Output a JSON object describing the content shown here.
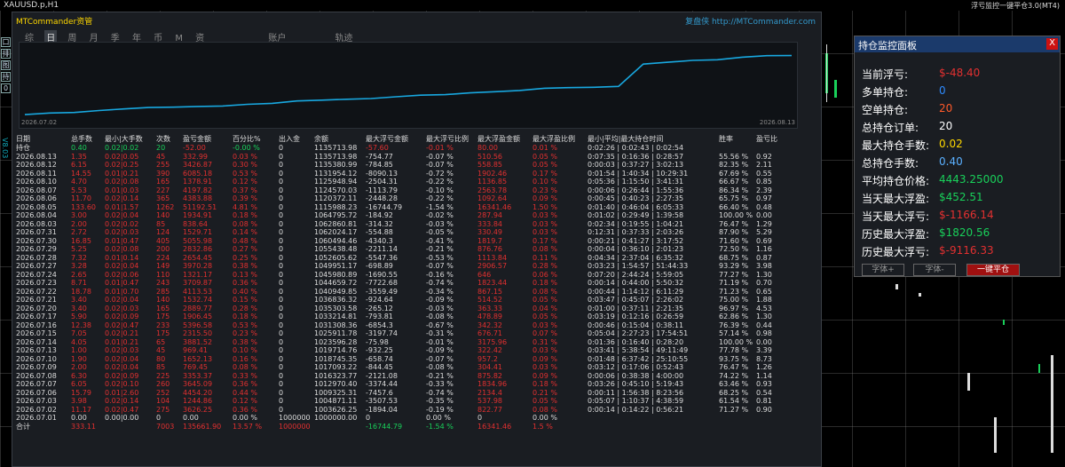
{
  "window": {
    "symbol": "XAUUSD.p,H1",
    "ea_name": "浮亏监控一键平仓3.0(MT4)"
  },
  "side_tools": [
    "口",
    "排",
    "图",
    "持",
    "0"
  ],
  "side_label": "V8.03",
  "panel": {
    "title": "MTCommander资管",
    "brand": "复盘侠 http://MTCommander.com",
    "tabs": [
      "综",
      "日",
      "周",
      "月",
      "季",
      "年",
      "币",
      "M",
      "资"
    ],
    "active_tab": "日",
    "sections": [
      "账户",
      "轨迹"
    ],
    "chart_dates": {
      "start": "2026.07.02",
      "end": "2026.08.13"
    },
    "headers": [
      "日期",
      "总手数",
      "最小|大手数",
      "次数",
      "盈亏金额",
      "百分比%",
      "出入金",
      "余额",
      "最大浮亏金额",
      "最大浮亏比例",
      "最大浮盈金额",
      "最大浮盈比例",
      "最小|平均|最大持仓时间",
      "胜率",
      "盈亏比"
    ],
    "holding_row": [
      "持仓",
      "0.40",
      "0.02|0.02",
      "20",
      "-52.00",
      "-0.00 %",
      "0",
      "1135713.98",
      "-57.60",
      "-0.01 %",
      "80.00",
      "0.01 %",
      "0:02:26 | 0:02:43 | 0:02:54",
      "",
      ""
    ],
    "rows": [
      [
        "2026.08.13",
        "1.35",
        "0.02|0.05",
        "45",
        "332.99",
        "0.03 %",
        "0",
        "1135713.98",
        "-754.77",
        "-0.07 %",
        "510.56",
        "0.05 %",
        "0:07:35 | 0:16:36 | 0:28:57",
        "55.56 %",
        "0.92"
      ],
      [
        "2026.08.12",
        "6.15",
        "0.02|0.25",
        "255",
        "3426.87",
        "0.30 %",
        "0",
        "1135380.99",
        "-784.85",
        "-0.07 %",
        "558.85",
        "0.05 %",
        "0:00:03 | 0:37:27 | 3:02:13",
        "82.35 %",
        "2.11"
      ],
      [
        "2026.08.11",
        "14.55",
        "0.01|0.21",
        "390",
        "6085.18",
        "0.53 %",
        "0",
        "1131954.12",
        "-8090.13",
        "-0.72 %",
        "1902.46",
        "0.17 %",
        "0:01:54 | 1:40:34 | 10:29:31",
        "67.69 %",
        "0.55"
      ],
      [
        "2026.08.10",
        "4.70",
        "0.02|0.08",
        "165",
        "1378.91",
        "0.12 %",
        "0",
        "1125948.94",
        "-2504.31",
        "-0.22 %",
        "1136.85",
        "0.10 %",
        "0:05:36 | 1:15:50 | 3:41:31",
        "66.67 %",
        "0.85"
      ],
      [
        "2026.08.07",
        "5.53",
        "0.01|0.03",
        "227",
        "4197.82",
        "0.37 %",
        "0",
        "1124570.03",
        "-1113.79",
        "-0.10 %",
        "2563.78",
        "0.23 %",
        "0:00:06 | 0:26:44 | 1:55:36",
        "86.34 %",
        "2.39"
      ],
      [
        "2026.08.06",
        "11.70",
        "0.02|0.14",
        "365",
        "4383.88",
        "0.39 %",
        "0",
        "1120372.11",
        "-2448.28",
        "-0.22 %",
        "1092.64",
        "0.09 %",
        "0:00:45 | 0:40:23 | 2:27:35",
        "65.75 %",
        "0.97"
      ],
      [
        "2026.08.05",
        "133.60",
        "0.01|1.57",
        "1262",
        "51192.51",
        "4.81 %",
        "0",
        "1115988.23",
        "-16744.79",
        "-1.54 %",
        "16341.46",
        "1.50 %",
        "0:01:40 | 0:46:04 | 6:05:33",
        "66.40 %",
        "0.48"
      ],
      [
        "2026.08.04",
        "3.00",
        "0.02|0.04",
        "140",
        "1934.91",
        "0.18 %",
        "0",
        "1064795.72",
        "-184.92",
        "-0.02 %",
        "287.94",
        "0.03 %",
        "0:01:02 | 0:29:49 | 1:39:58",
        "100.00 %",
        "0.00"
      ],
      [
        "2026.08.03",
        "2.00",
        "0.02|0.02",
        "85",
        "838.64",
        "0.08 %",
        "0",
        "1062860.81",
        "-314.32",
        "-0.03 %",
        "333.84",
        "0.03 %",
        "0:02:34 | 0:19:55 | 1:04:21",
        "76.47 %",
        "1.29"
      ],
      [
        "2026.07.31",
        "2.72",
        "0.02|0.03",
        "124",
        "1529.71",
        "0.14 %",
        "0",
        "1062024.17",
        "-554.88",
        "-0.05 %",
        "330.49",
        "0.03 %",
        "0:12:31 | 0:37:33 | 2:03:26",
        "87.90 %",
        "5.29"
      ],
      [
        "2026.07.30",
        "16.85",
        "0.01|0.47",
        "405",
        "5055.98",
        "0.48 %",
        "0",
        "1060494.46",
        "-4340.3",
        "-0.41 %",
        "1819.7",
        "0.17 %",
        "0:00:21 | 0:41:27 | 3:17:52",
        "71.60 %",
        "0.69"
      ],
      [
        "2026.07.29",
        "5.25",
        "0.02|0.08",
        "200",
        "2832.86",
        "0.27 %",
        "0",
        "1055438.48",
        "-2211.14",
        "-0.21 %",
        "876.76",
        "0.08 %",
        "0:00:04 | 0:36:10 | 2:01:23",
        "72.50 %",
        "1.16"
      ],
      [
        "2026.07.28",
        "7.32",
        "0.01|0.14",
        "224",
        "2654.45",
        "0.25 %",
        "0",
        "1052605.62",
        "-5547.36",
        "-0.53 %",
        "1113.84",
        "0.11 %",
        "0:04:34 | 2:37:04 | 6:35:32",
        "68.75 %",
        "0.87"
      ],
      [
        "2026.07.27",
        "3.28",
        "0.02|0.04",
        "149",
        "3970.28",
        "0.38 %",
        "0",
        "1049951.17",
        "-698.89",
        "-0.07 %",
        "2906.57",
        "0.28 %",
        "0:03:23 | 1:54:57 | 51:44:33",
        "93.29 %",
        "3.98"
      ],
      [
        "2026.07.24",
        "2.65",
        "0.02|0.06",
        "110",
        "1321.17",
        "0.13 %",
        "0",
        "1045980.89",
        "-1690.55",
        "-0.16 %",
        "646",
        "0.06 %",
        "0:07:20 | 2:44:24 | 5:59:05",
        "77.27 %",
        "1.30"
      ],
      [
        "2026.07.23",
        "8.71",
        "0.01|0.47",
        "243",
        "3709.87",
        "0.36 %",
        "0",
        "1044659.72",
        "-7722.68",
        "-0.74 %",
        "1823.44",
        "0.18 %",
        "0:00:14 | 0:44:00 | 5:50:32",
        "71.19 %",
        "0.70"
      ],
      [
        "2026.07.22",
        "18.78",
        "0.01|0.70",
        "285",
        "4113.53",
        "0.40 %",
        "0",
        "1040949.85",
        "-3559.49",
        "-0.34 %",
        "867.15",
        "0.08 %",
        "0:00:44 | 1:14:12 | 6:11:29",
        "71.23 %",
        "0.65"
      ],
      [
        "2026.07.21",
        "3.40",
        "0.02|0.04",
        "140",
        "1532.74",
        "0.15 %",
        "0",
        "1036836.32",
        "-924.64",
        "-0.09 %",
        "514.52",
        "0.05 %",
        "0:03:47 | 0:45:07 | 2:26:02",
        "75.00 %",
        "1.88"
      ],
      [
        "2026.07.20",
        "3.40",
        "0.02|0.03",
        "165",
        "2889.77",
        "0.28 %",
        "0",
        "1035303.58",
        "-265.12",
        "-0.03 %",
        "363.33",
        "0.04 %",
        "0:01:00 | 0:37:11 | 2:21:35",
        "96.97 %",
        "4.53"
      ],
      [
        "2026.07.17",
        "5.90",
        "0.02|0.09",
        "175",
        "1906.45",
        "0.18 %",
        "0",
        "1033214.81",
        "-793.81",
        "-0.08 %",
        "478.89",
        "0.05 %",
        "0:03:19 | 0:12:16 | 0:26:59",
        "62.86 %",
        "1.30"
      ],
      [
        "2026.07.16",
        "12.38",
        "0.02|0.47",
        "233",
        "5396.58",
        "0.53 %",
        "0",
        "1031308.36",
        "-6854.3",
        "-0.67 %",
        "342.32",
        "0.03 %",
        "0:00:46 | 0:15:04 | 0:38:11",
        "76.39 %",
        "0.44"
      ],
      [
        "2026.07.15",
        "7.05",
        "0.02|0.21",
        "175",
        "2315.50",
        "0.23 %",
        "0",
        "1025911.78",
        "-3197.74",
        "-0.31 %",
        "676.71",
        "0.07 %",
        "0:05:04 | 2:27:23 | 17:54:51",
        "57.14 %",
        "0.98"
      ],
      [
        "2026.07.14",
        "4.05",
        "0.01|0.21",
        "65",
        "3881.52",
        "0.38 %",
        "0",
        "1023596.28",
        "-75.98",
        "-0.01 %",
        "3175.96",
        "0.31 %",
        "0:01:36 | 0:16:40 | 0:28:20",
        "100.00 %",
        "0.00"
      ],
      [
        "2026.07.13",
        "1.00",
        "0.02|0.03",
        "45",
        "969.41",
        "0.10 %",
        "0",
        "1019714.76",
        "-932.25",
        "-0.09 %",
        "322.42",
        "0.03 %",
        "0:03:41 | 5:38:54 | 49:11:49",
        "77.78 %",
        "3.39"
      ],
      [
        "2026.07.10",
        "1.90",
        "0.02|0.04",
        "80",
        "1652.13",
        "0.16 %",
        "0",
        "1018745.35",
        "-658.74",
        "-0.07 %",
        "957.2",
        "0.09 %",
        "0:01:48 | 6:37:42 | 25:10:55",
        "93.75 %",
        "8.73"
      ],
      [
        "2026.07.09",
        "2.00",
        "0.02|0.04",
        "85",
        "769.45",
        "0.08 %",
        "0",
        "1017093.22",
        "-844.45",
        "-0.08 %",
        "304.41",
        "0.03 %",
        "0:03:12 | 0:17:06 | 0:52:43",
        "76.47 %",
        "1.26"
      ],
      [
        "2026.07.08",
        "6.30",
        "0.02|0.09",
        "225",
        "3353.37",
        "0.33 %",
        "0",
        "1016323.77",
        "-2121.08",
        "-0.21 %",
        "875.82",
        "0.09 %",
        "0:00:06 | 0:38:38 | 4:00:00",
        "74.22 %",
        "1.14"
      ],
      [
        "2026.07.07",
        "6.05",
        "0.02|0.10",
        "260",
        "3645.09",
        "0.36 %",
        "0",
        "1012970.40",
        "-3374.44",
        "-0.33 %",
        "1834.96",
        "0.18 %",
        "0:03:26 | 0:45:10 | 5:19:43",
        "63.46 %",
        "0.93"
      ],
      [
        "2026.07.06",
        "15.79",
        "0.01|2.60",
        "252",
        "4454.20",
        "0.44 %",
        "0",
        "1009325.31",
        "-7457.6",
        "-0.74 %",
        "2134.4",
        "0.21 %",
        "0:00:11 | 1:56:38 | 8:23:56",
        "68.25 %",
        "0.54"
      ],
      [
        "2026.07.03",
        "3.98",
        "0.02|0.14",
        "104",
        "1244.86",
        "0.12 %",
        "0",
        "1004871.11",
        "-3507.53",
        "-0.35 %",
        "537.98",
        "0.05 %",
        "0:05:07 | 1:10:37 | 4:38:59",
        "61.54 %",
        "0.81"
      ],
      [
        "2026.07.02",
        "11.17",
        "0.02|0.47",
        "275",
        "3626.25",
        "0.36 %",
        "0",
        "1003626.25",
        "-1894.04",
        "-0.19 %",
        "822.77",
        "0.08 %",
        "0:00:14 | 0:14:22 | 0:56:21",
        "71.27 %",
        "0.90"
      ],
      [
        "2026.07.01",
        "0.00",
        "0.00|0.00",
        "0",
        "0.00",
        "0.00 %",
        "1000000",
        "1000000.00",
        "0",
        "0.00 %",
        "0",
        "0.00 %",
        "",
        "",
        ""
      ]
    ],
    "total_row": [
      "合计",
      "333.11",
      "",
      "7003",
      "135661.90",
      "13.57 %",
      "1000000",
      "",
      "-16744.79",
      "-1.54 %",
      "16341.46",
      "1.5 %",
      "",
      "",
      ""
    ]
  },
  "equity_curve": [
    1000000,
    1003626,
    1004871,
    1009325,
    1012970,
    1016324,
    1017093,
    1018745,
    1019715,
    1023596,
    1025912,
    1031308,
    1033215,
    1035304,
    1036836,
    1040950,
    1044660,
    1045981,
    1049951,
    1052606,
    1055438,
    1060494,
    1062024,
    1062861,
    1064796,
    1115988,
    1120372,
    1124570,
    1125949,
    1131954,
    1135381,
    1135714
  ],
  "monitor": {
    "title": "持仓监控面板",
    "items": [
      {
        "label": "当前浮亏:",
        "value": "$-48.40",
        "color": "#e23030"
      },
      {
        "label": "多单持仓:",
        "value": "0",
        "color": "#2e8bff"
      },
      {
        "label": "空单持仓:",
        "value": "20",
        "color": "#ff5a2a"
      },
      {
        "label": "总持仓订单:",
        "value": "20",
        "color": "#ffffff"
      },
      {
        "label": "最大持仓手数:",
        "value": "0.02",
        "color": "#ffd800"
      },
      {
        "label": "总持仓手数:",
        "value": "0.40",
        "color": "#5ab0ff"
      },
      {
        "label": "平均持仓价格:",
        "value": "4443.25000",
        "color": "#19d05a"
      },
      {
        "label": "当天最大浮盈:",
        "value": "$452.51",
        "color": "#19d05a"
      },
      {
        "label": "当天最大浮亏:",
        "value": "$-1166.14",
        "color": "#e23030"
      },
      {
        "label": "历史最大浮盈:",
        "value": "$1820.56",
        "color": "#19d05a"
      },
      {
        "label": "历史最大浮亏:",
        "value": "$-9116.33",
        "color": "#e23030"
      }
    ],
    "btn_font_plus": "字体+",
    "btn_font_minus": "字体-",
    "btn_close_all": "一键平仓"
  }
}
